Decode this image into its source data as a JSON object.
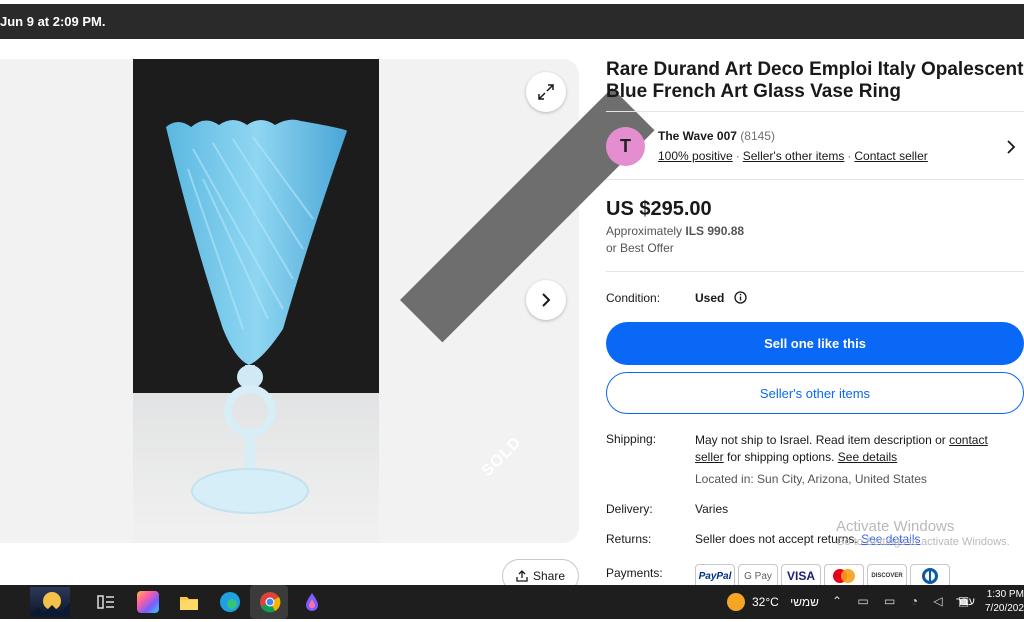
{
  "top_bar": {
    "text": "Jun 9 at 2:09 PM."
  },
  "gallery": {
    "sold_label": "SOLD",
    "share_label": "Share"
  },
  "listing": {
    "title": "Rare Durand Art Deco Emploi Italy Opalescent Blue French Art Glass Vase Ring",
    "seller": {
      "avatar_letter": "T",
      "name": "The Wave 007",
      "count": "(8145)",
      "positive": "100% positive",
      "other_items": "Seller's other items",
      "contact": "Contact seller"
    },
    "price": "US $295.00",
    "approx_prefix": "Approximately",
    "approx_value": "ILS 990.88",
    "offer": "or Best Offer",
    "condition_label": "Condition:",
    "condition_value": "Used",
    "sell_button": "Sell one like this",
    "other_items_button": "Seller's other items",
    "shipping_label": "Shipping:",
    "shipping_text_1": "May not ship to Israel. Read item description or",
    "shipping_link_1": "contact seller",
    "shipping_text_2": "for shipping options.",
    "shipping_link_2": "See details",
    "located": "Located in: Sun City, Arizona, United States",
    "delivery_label": "Delivery:",
    "delivery_value": "Varies",
    "returns_label": "Returns:",
    "returns_value": "Seller does not accept returns.",
    "returns_link": "See details",
    "payments_label": "Payments:",
    "payments": [
      "PayPal",
      "G Pay",
      "VISA",
      "",
      "DISCOVER",
      ""
    ]
  },
  "watermark": {
    "line1": "Activate Windows",
    "line2": "Go to Settings to activate Windows."
  },
  "taskbar": {
    "temperature": "32°C",
    "weather_word": "שמשי",
    "lang": "עבר",
    "time": "1:30 PM",
    "date": "7/20/202"
  },
  "colors": {
    "accent": "#0968f6",
    "avatar": "#e58ecf",
    "sold_band": "#6e6e6e"
  }
}
